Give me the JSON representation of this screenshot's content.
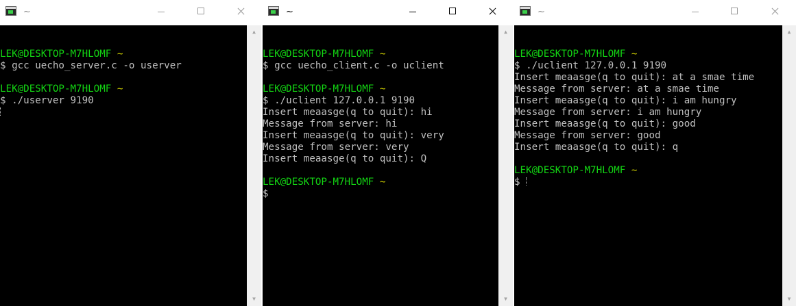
{
  "windows": [
    {
      "title": "~",
      "lines": [
        {
          "type": "blank"
        },
        {
          "type": "prompt",
          "user": "LEK@DESKTOP-M7HLOMF",
          "tilde": "~"
        },
        {
          "type": "text",
          "text": "$ gcc uecho_server.c -o userver"
        },
        {
          "type": "blank"
        },
        {
          "type": "prompt",
          "user": "LEK@DESKTOP-M7HLOMF",
          "tilde": "~"
        },
        {
          "type": "text",
          "text": "$ ./userver 9190"
        },
        {
          "type": "cursor"
        }
      ]
    },
    {
      "title": "~",
      "lines": [
        {
          "type": "blank"
        },
        {
          "type": "prompt",
          "user": "LEK@DESKTOP-M7HLOMF",
          "tilde": "~"
        },
        {
          "type": "text",
          "text": "$ gcc uecho_client.c -o uclient"
        },
        {
          "type": "blank"
        },
        {
          "type": "prompt",
          "user": "LEK@DESKTOP-M7HLOMF",
          "tilde": "~"
        },
        {
          "type": "text",
          "text": "$ ./uclient 127.0.0.1 9190"
        },
        {
          "type": "text",
          "text": "Insert meaasge(q to quit): hi"
        },
        {
          "type": "text",
          "text": "Message from server: hi"
        },
        {
          "type": "text",
          "text": "Insert meaasge(q to quit): very"
        },
        {
          "type": "text",
          "text": "Message from server: very"
        },
        {
          "type": "text",
          "text": "Insert meaasge(q to quit): Q"
        },
        {
          "type": "blank"
        },
        {
          "type": "prompt",
          "user": "LEK@DESKTOP-M7HLOMF",
          "tilde": "~"
        },
        {
          "type": "text",
          "text": "$"
        }
      ]
    },
    {
      "title": "~",
      "lines": [
        {
          "type": "blank"
        },
        {
          "type": "prompt",
          "user": "LEK@DESKTOP-M7HLOMF",
          "tilde": "~"
        },
        {
          "type": "text",
          "text": "$ ./uclient 127.0.0.1 9190"
        },
        {
          "type": "text",
          "text": "Insert meaasge(q to quit): at a smae time"
        },
        {
          "type": "text",
          "text": "Message from server: at a smae time"
        },
        {
          "type": "text",
          "text": "Insert meaasge(q to quit): i am hungry"
        },
        {
          "type": "text",
          "text": "Message from server: i am hungry"
        },
        {
          "type": "text",
          "text": "Insert meaasge(q to quit): good"
        },
        {
          "type": "text",
          "text": "Message from server: good"
        },
        {
          "type": "text",
          "text": "Insert meaasge(q to quit): q"
        },
        {
          "type": "blank"
        },
        {
          "type": "prompt",
          "user": "LEK@DESKTOP-M7HLOMF",
          "tilde": "~"
        },
        {
          "type": "cursor-prompt",
          "text": "$"
        }
      ]
    }
  ],
  "icons": {
    "app": "terminal-app-icon",
    "minimize": "minimize-icon",
    "maximize": "maximize-icon",
    "close": "close-icon",
    "scroll_up": "scroll-up-arrow-icon",
    "scroll_down": "scroll-down-arrow-icon"
  },
  "colors": {
    "terminal_bg": "#000000",
    "text": "#c0c0c0",
    "user_host": "#13d613",
    "tilde": "#d2d200"
  }
}
